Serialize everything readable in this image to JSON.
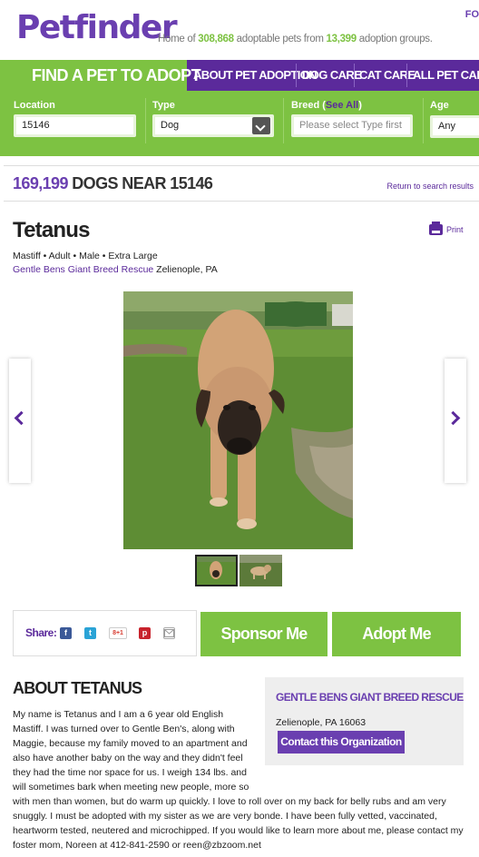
{
  "header": {
    "logo_text": "Petfinder",
    "tagline_prefix": "Home of ",
    "pets_count": "308,868",
    "tagline_mid": " adoptable pets from ",
    "groups_count": "13,399",
    "tagline_suffix": " adoption groups.",
    "corner_link": "FO"
  },
  "nav": {
    "active": "FIND A PET TO ADOPT",
    "items": [
      "ABOUT PET ADOPTION",
      "DOG CARE",
      "CAT CARE",
      "ALL PET CARE"
    ]
  },
  "search": {
    "location_label": "Location",
    "location_value": "15146",
    "type_label": "Type",
    "type_value": "Dog",
    "breed_label": "Breed",
    "breed_see_all": "See All",
    "breed_placeholder": "Please select Type first",
    "age_label": "Age",
    "age_value": "Any"
  },
  "results": {
    "count": "169,199",
    "label": "DOGS NEAR 15146",
    "return_link": "Return to search results"
  },
  "pet": {
    "name": "Tetanus",
    "print_label": "Print",
    "meta": "Mastiff • Adult • Male • Extra Large",
    "org_name": "Gentle Bens Giant Breed Rescue",
    "org_location": " Zelienople, PA"
  },
  "share": {
    "label": "Share:",
    "icons": [
      "facebook-icon",
      "twitter-icon",
      "google-plus-icon",
      "pinterest-icon",
      "email-icon"
    ],
    "gplus_text": "8+1"
  },
  "actions": {
    "sponsor": "Sponsor Me",
    "adopt": "Adopt Me"
  },
  "about": {
    "title": "ABOUT TETANUS",
    "body": "My name is Tetanus and I am a 6 year old English Mastiff. I was turned over to Gentle Ben's, along with Maggie, because my family moved to an apartment and also have another baby on the way and they didn't feel they had the time nor space for us. I weigh 134 lbs. and will sometimes bark when meeting new people, more so with men than women, but do warm up quickly. I love to roll over on my back for belly rubs and am very snuggly. I must be adopted with my sister as we are very bonde. I have been fully vetted, vaccinated, heartworm tested, neutered and microchipped. If you would like to learn more about me, please contact my foster mom, Noreen at 412-841-2590 or reen@zbzoom.net"
  },
  "org_box": {
    "title": "GENTLE BENS GIANT BREED RESCUE",
    "location": "Zelienople, PA 16063",
    "contact_button": "Contact this Organization"
  },
  "colors": {
    "purple": "#5b2a9b",
    "green": "#7dc242"
  }
}
